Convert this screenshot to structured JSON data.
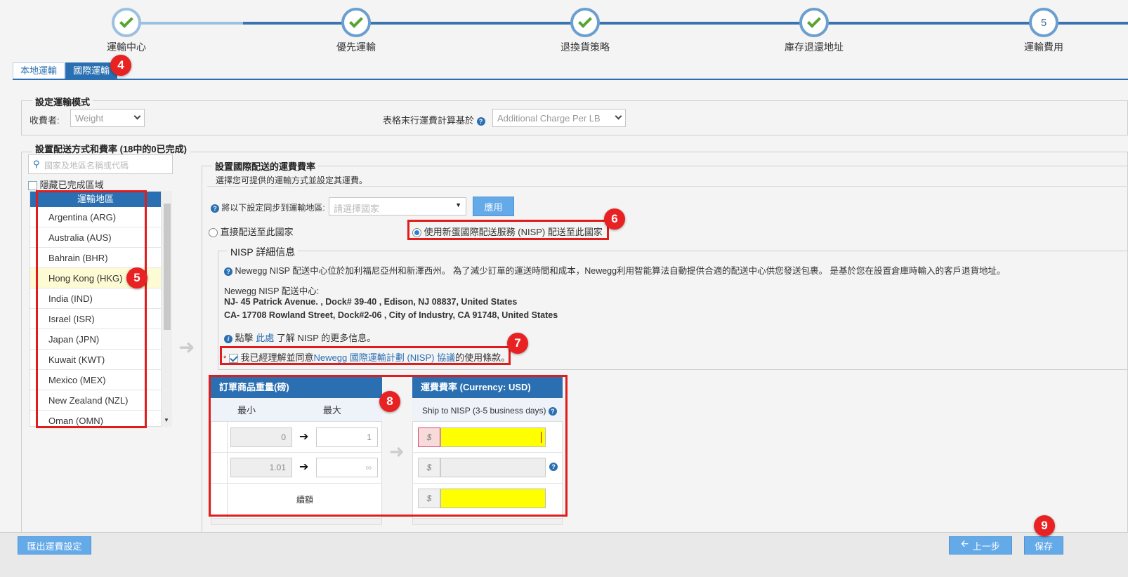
{
  "steps": [
    {
      "label": "運輸中心",
      "state": "done"
    },
    {
      "label": "優先運輸",
      "state": "done"
    },
    {
      "label": "退換貨策略",
      "state": "done"
    },
    {
      "label": "庫存退還地址",
      "state": "done"
    },
    {
      "label": "運輸費用",
      "state": "current",
      "number": "5"
    }
  ],
  "tabs": {
    "local": "本地運輸",
    "international": "國際運輸"
  },
  "badges": {
    "b4": "4",
    "b5": "5",
    "b6": "6",
    "b7": "7",
    "b8": "8",
    "b9": "9"
  },
  "mode": {
    "legend": "設定運輸模式",
    "charge_by_label": "收費者:",
    "charge_by_value": "Weight",
    "last_row_label": "表格末行運費計算基於",
    "last_row_value": "Additional Charge Per LB"
  },
  "methods": {
    "legend": "設置配送方式和費率 (18中的0已完成)",
    "search_placeholder": "國家及地區名稱或代碼",
    "hide_completed": "隱藏已完成區域",
    "region_header": "運輸地區",
    "regions": [
      "Argentina (ARG)",
      "Australia (AUS)",
      "Bahrain (BHR)",
      "Hong Kong (HKG)",
      "India (IND)",
      "Israel (ISR)",
      "Japan (JPN)",
      "Kuwait (KWT)",
      "Mexico (MEX)",
      "New Zealand (NZL)",
      "Oman (OMN)"
    ],
    "selected_region_index": 3
  },
  "intl": {
    "legend": "設置國際配送的運費費率",
    "subtitle": "選擇您可提供的運輸方式並設定其運費。",
    "sync_label": "將以下設定同步到運輸地區:",
    "sync_placeholder": "請選擇國家",
    "apply": "應用",
    "radio_direct": "直接配送至此國家",
    "radio_nisp": "使用新蛋國際配送服務 (NISP) 配送至此國家"
  },
  "nisp": {
    "legend": "NISP 詳細信息",
    "info": "Newegg NISP 配送中心位於加利福尼亞州和新澤西州。 為了減少訂單的運送時間和成本，Newegg利用智能算法自動提供合適的配送中心供您發送包裹。 是基於您在設置倉庫時輸入的客戶退貨地址。",
    "center_title": "Newegg NISP 配送中心:",
    "center_nj": "NJ- 45 Patrick Avenue. , Dock# 39-40 , Edison, NJ 08837, United States",
    "center_ca": "CA- 17708 Rowland Street, Dock#2-06 , City of Industry, CA 91748, United States",
    "more_prefix": "點擊",
    "more_link": "此處",
    "more_suffix": "了解 NISP 的更多信息。",
    "agree_asterisk": "*",
    "agree_prefix": "我已經理解並同意",
    "agree_link": "Newegg 國際運輸計劃 (NISP) 協議",
    "agree_suffix": "的使用條款。"
  },
  "weight_table": {
    "title": "訂單商品重量(磅)",
    "min": "最小",
    "max": "最大",
    "rows": [
      {
        "min": "0",
        "max": "1"
      },
      {
        "min": "1.01",
        "max": "∞"
      }
    ],
    "continue_label": "續額"
  },
  "rate_table": {
    "title": "運費費率 (Currency: USD)",
    "sub": "Ship to NISP (3-5 business days)",
    "currency_symbol": "$"
  },
  "footer": {
    "export": "匯出運費設定",
    "prev": "上一步",
    "save": "保存"
  },
  "colors": {
    "primary": "#2a6fb1",
    "button": "#64a9e8",
    "highlight": "#ffff00",
    "annotation": "#e11c1c"
  }
}
